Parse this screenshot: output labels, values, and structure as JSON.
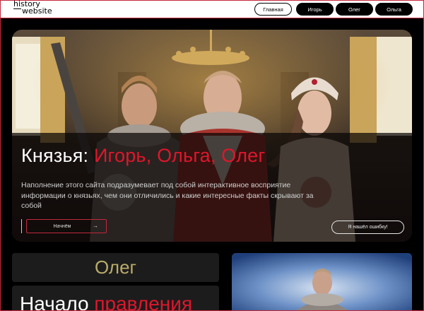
{
  "header": {
    "logo_line1": "history",
    "logo_line2": "website",
    "nav": {
      "home": "Главная",
      "igor": "Игорь",
      "oleg": "Олег",
      "olga": "Ольга"
    }
  },
  "hero": {
    "title_prefix": "Князья: ",
    "title_names": "Игорь, Ольга, Олег",
    "description": "Наполнение этого сайта подразумевает под собой интерактивное восприятие информации о князьях, чем они отличились и какие интересные факты скрывают за собой",
    "start_button": "Начнём",
    "start_arrow": "→",
    "error_button": "Я нашёл ошибку!"
  },
  "section": {
    "name": "Олег",
    "heading_prefix": "Начало ",
    "heading_accent": "правления"
  },
  "colors": {
    "accent_red": "#e0162b",
    "gold": "#b9ab6b",
    "border_red": "#c2283c"
  }
}
